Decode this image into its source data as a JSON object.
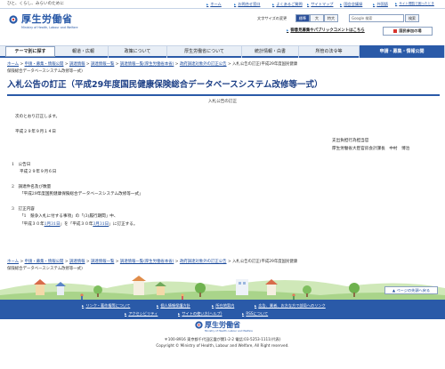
{
  "top": {
    "tagline": "ひと、くらし、みらいのために",
    "links": [
      "ホーム",
      "お問合せ窓口",
      "よくあるご質問",
      "サイトマップ",
      "国会会議録",
      "外国語",
      "サイト閲覧で困ったとき"
    ]
  },
  "header": {
    "logo_title": "厚生労働省",
    "logo_sub": "Ministry of Health, Labour and Welfare",
    "fontsize_label": "文字サイズの変更",
    "fontsize_options": [
      "標準",
      "大",
      "特大"
    ],
    "search_placeholder": "Google 検索",
    "search_button": "検索",
    "opinion_link": "御意見募集やパブリックコメントはこちら",
    "kokumin_button": "国民参加の場"
  },
  "gnav": [
    "テーマ別に探す",
    "報道・広報",
    "政策について",
    "厚生労働省について",
    "統計情報・白書",
    "所管の法令等",
    "申請・募集・情報公開"
  ],
  "breadcrumb": {
    "items": [
      "ホーム",
      "申請・募集・情報公開",
      "調達情報",
      "調達情報一覧",
      "調達情報一覧(厚生労働省本省)",
      "政府調達対象外の訂正公告",
      "入札公告の訂正(平成29年度国民健康"
    ],
    "tail": "保険総合データベースシステム改修等一式)"
  },
  "breadcrumb_bottom": {
    "items": [
      "ホーム",
      "申請・募集・情報公開",
      "調達情報",
      "調達情報一覧",
      "調達情報一覧(厚生労働省本省)",
      "政府調達対象外の訂正公告"
    ],
    "current": "入札公告の訂正(平成29年度国民健康",
    "tail": "保険総合データベースシステム改修等一式)"
  },
  "page_title": "入札公告の訂正（平成29年度国民健康保険総合データベースシステム改修等一式）",
  "doc": {
    "title": "入札公告の訂正",
    "intro": "次のとおり訂正します。",
    "date": "平成２９年９月１４日",
    "issuer1": "支出負担行為担当官",
    "issuer2": "厚生労働省大臣官房会計課長　中村　博治",
    "s1_head": "1　公告日",
    "s1_body": "平成２９年９月６日",
    "s2_head": "2　調達件名及び数量",
    "s2_body": "「平成29年度国民健康保険総合データベースシステム改修等一式」",
    "s3_head": "3　訂正内容",
    "s3_line1": "「1　競争入札に付する事項」の「(3)履行期間」中、",
    "s3_pre": "「平成３０年",
    "s3_old": "1月31日",
    "s3_mid": "」を「平成３０年",
    "s3_new": "3月31日",
    "s3_post": "」に訂正する。"
  },
  "page_top_button": "ページの先頭へ戻る",
  "footer": {
    "nav_row1": [
      "リンク・著作権等について",
      "個人情報保護方針",
      "所在地案内",
      "広告、業者、お方な方で部局へのリンク"
    ],
    "nav_row2": [
      "アクセシビリティ",
      "サイトの使い方(ヘルプ)",
      "RSSについて"
    ],
    "logo": "厚生労働省",
    "logo_sub": "Ministry of Health, Labour and Welfare",
    "address": "〒100-8916 東京都千代田区霞が関1-2-2 電話:03-5253-1111(代表)",
    "copyright": "Copyright © Ministry of Health, Labour and Welfare, All Right reserved."
  }
}
